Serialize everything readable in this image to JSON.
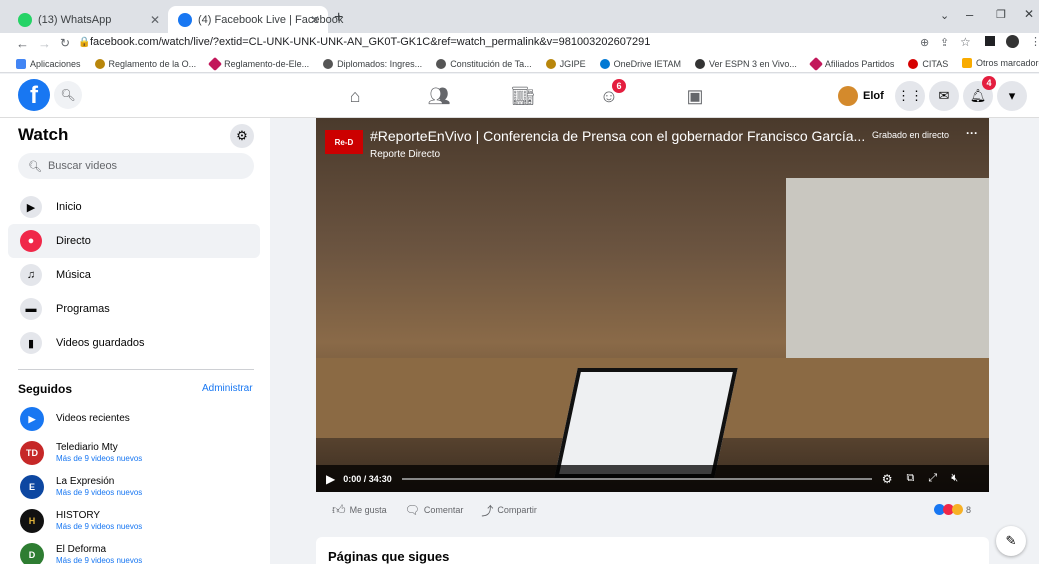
{
  "browser": {
    "tabs": [
      {
        "title": "(13) WhatsApp",
        "active": false
      },
      {
        "title": "(4) Facebook Live | Facebook",
        "active": true
      }
    ],
    "url": "facebook.com/watch/live/?extid=CL-UNK-UNK-UNK-AN_GK0T-GK1C&ref=watch_permalink&v=981003202607291",
    "bookmarks": [
      "Aplicaciones",
      "Reglamento de la O...",
      "Reglamento-de-Ele...",
      "Diplomados: Ingres...",
      "Constitución de Ta...",
      "JGIPE",
      "OneDrive IETAM",
      "Ver ESPN 3 en Vivo...",
      "Afiliados Partidos",
      "CITAS"
    ],
    "other_bookmarks": "Otros marcadores"
  },
  "fb": {
    "user_name": "Elof",
    "groups_badge": "6",
    "notif_badge": "4"
  },
  "sidebar": {
    "title": "Watch",
    "search_placeholder": "Buscar videos",
    "items": [
      {
        "label": "Inicio",
        "icon": "home-icon"
      },
      {
        "label": "Directo",
        "icon": "live-icon"
      },
      {
        "label": "Música",
        "icon": "music-icon"
      },
      {
        "label": "Programas",
        "icon": "shows-icon"
      },
      {
        "label": "Videos guardados",
        "icon": "bookmark-icon"
      }
    ],
    "following_title": "Seguidos",
    "manage_label": "Administrar",
    "following": [
      {
        "name": "Videos recientes",
        "sub": ""
      },
      {
        "name": "Telediario Mty",
        "sub": "Más de 9 videos nuevos"
      },
      {
        "name": "La Expresión",
        "sub": "Más de 9 videos nuevos"
      },
      {
        "name": "HISTORY",
        "sub": "Más de 9 videos nuevos"
      },
      {
        "name": "El Deforma",
        "sub": "Más de 9 videos nuevos"
      }
    ]
  },
  "video": {
    "title": "#ReporteEnVivo | Conferencia de Prensa con el gobernador Francisco García...",
    "channel": "Reporte Directo",
    "recorded_label": "Grabado en directo",
    "logo_text": "Re-D",
    "time": "0:00 / 34:30"
  },
  "actions": {
    "like": "Me gusta",
    "comment": "Comentar",
    "share": "Compartir",
    "reactions_count": "8"
  },
  "pages_title": "Páginas que sigues"
}
